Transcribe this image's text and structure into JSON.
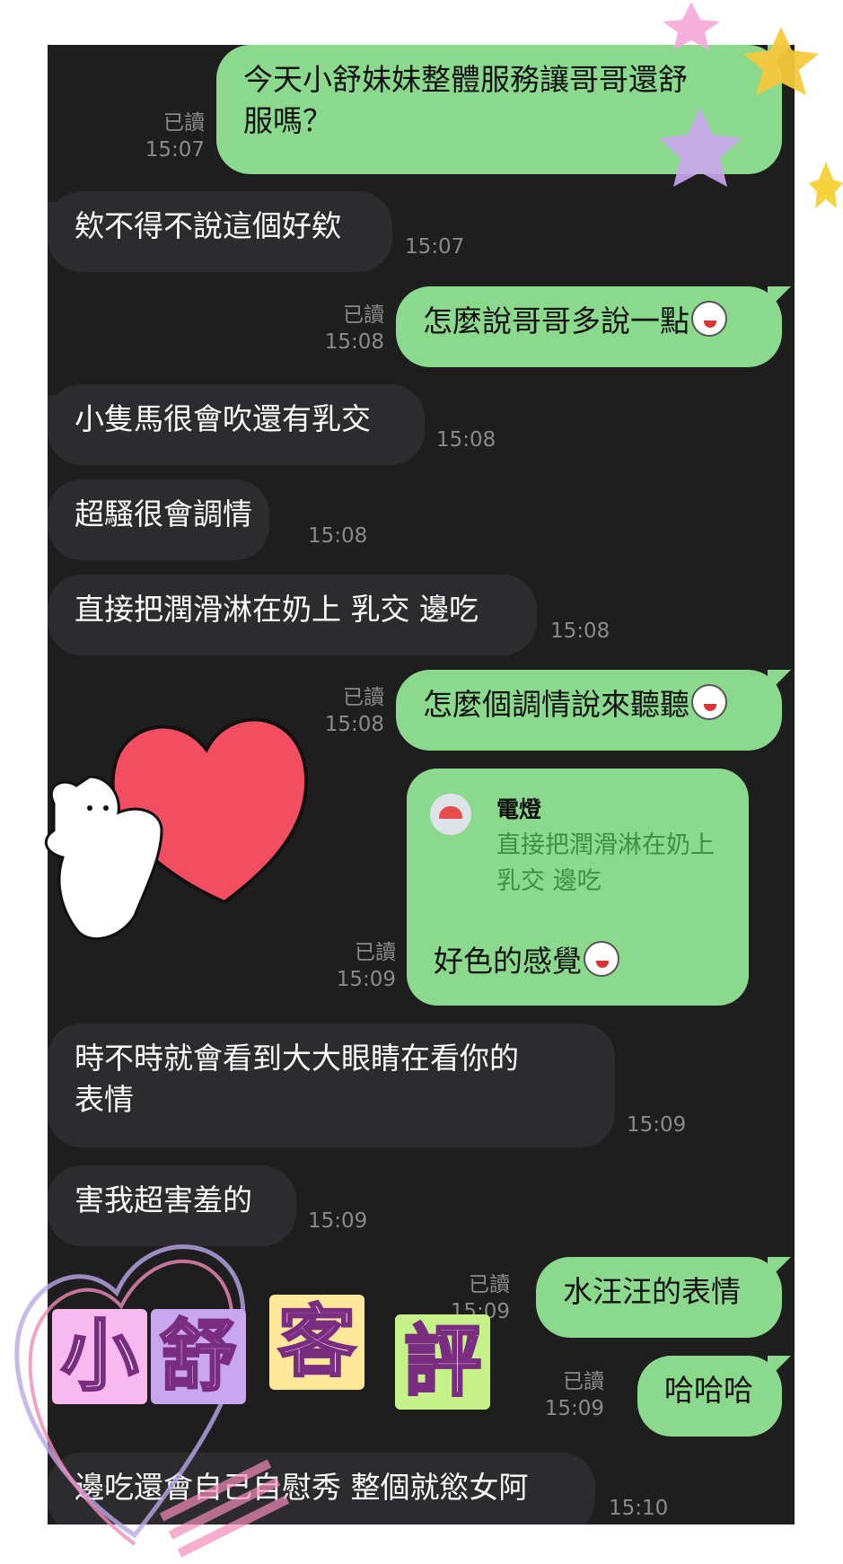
{
  "messages": [
    {
      "side": "sent",
      "text": "今天小舒妹妹整體服務讓哥哥還舒\n服嗎？",
      "read": "已讀",
      "time": "15:07"
    },
    {
      "side": "recv",
      "text": "欸不得不說這個好欸",
      "time": "15:07"
    },
    {
      "side": "sent",
      "text": "怎麼說哥哥多說一點",
      "emoji": "blushing-face-sticker",
      "read": "已讀",
      "time": "15:08"
    },
    {
      "side": "recv",
      "text": "小隻馬很會吹還有乳交",
      "time": "15:08"
    },
    {
      "side": "recv",
      "text": "超騷很會調情",
      "time": "15:08"
    },
    {
      "side": "recv",
      "text": "直接把潤滑淋在奶上 乳交 邊吃",
      "time": "15:08"
    },
    {
      "side": "sent",
      "text": "怎麼個調情說來聽聽",
      "emoji": "rabbit-face-sticker",
      "read": "已讀",
      "time": "15:08"
    },
    {
      "side": "sent",
      "reply_to": {
        "name": "電燈",
        "text": "直接把潤滑淋在奶上\n乳交 邊吃"
      },
      "text": "好色的感覺",
      "emoji": "laughing-face-sticker",
      "read": "已讀",
      "time": "15:09"
    },
    {
      "side": "recv",
      "text": "時不時就會看到大大眼睛在看你的\n表情",
      "time": "15:09"
    },
    {
      "side": "recv",
      "text": "害我超害羞的",
      "time": "15:09"
    },
    {
      "side": "sent",
      "text": "水汪汪的表情",
      "read": "已讀",
      "time": "15:09"
    },
    {
      "side": "sent",
      "text": "哈哈哈",
      "read": "已讀",
      "time": "15:09"
    },
    {
      "side": "recv",
      "text": "邊吃還會自己自慰秀 整個就慾女阿",
      "time": "15:10"
    }
  ],
  "overlay": {
    "title_chars": [
      "小",
      "舒",
      "客",
      "評"
    ],
    "title_colors": [
      "#f7b9ee",
      "#c9a6f0",
      "#ffe89a",
      "#c6f28a"
    ]
  },
  "colors": {
    "chat_bg": "#1e1e1e",
    "sent_bubble": "#8bd98c",
    "recv_bubble": "#2c2c2e"
  }
}
